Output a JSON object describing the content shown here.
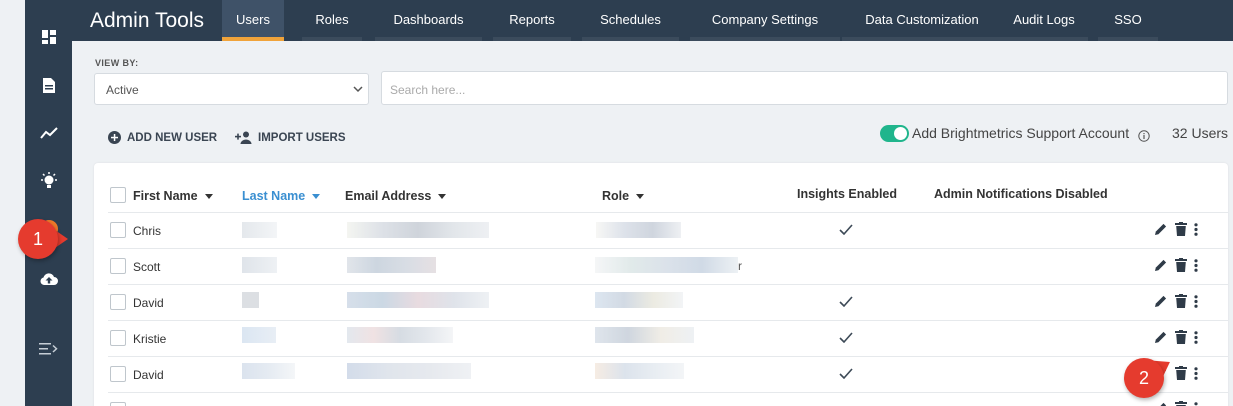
{
  "header": {
    "title": "Admin Tools",
    "tabs": [
      {
        "label": "Users",
        "active": true
      },
      {
        "label": "Roles"
      },
      {
        "label": "Dashboards"
      },
      {
        "label": "Reports"
      },
      {
        "label": "Schedules"
      },
      {
        "label": "Company Settings"
      },
      {
        "label": "Data Customization"
      },
      {
        "label": "Audit Logs"
      },
      {
        "label": "SSO"
      }
    ]
  },
  "sidebar": {
    "items": [
      {
        "icon": "dashboard-icon"
      },
      {
        "icon": "document-icon"
      },
      {
        "icon": "trend-line-icon"
      },
      {
        "icon": "lightbulb-icon"
      },
      {
        "icon": "admin-badge-icon"
      },
      {
        "icon": "cloud-upload-icon"
      },
      {
        "icon": "expand-menu-icon"
      }
    ]
  },
  "filters": {
    "view_by_label": "VIEW BY:",
    "view_by_value": "Active",
    "search_placeholder": "Search here..."
  },
  "actions": {
    "add_user": "ADD NEW USER",
    "import_users": "IMPORT USERS",
    "support_toggle_label": "Add Brightmetrics Support Account",
    "support_toggle_on": true,
    "user_count": "32 Users"
  },
  "table": {
    "columns": {
      "first_name": "First Name",
      "last_name": "Last Name",
      "email": "Email Address",
      "role": "Role",
      "insights": "Insights Enabled",
      "admin_notifications": "Admin Notifications Disabled"
    },
    "sorted_column": "Last Name",
    "rows": [
      {
        "first_name": "Chris",
        "insights_enabled": true,
        "role_suffix": ""
      },
      {
        "first_name": "Scott",
        "insights_enabled": false,
        "role_suffix": "r"
      },
      {
        "first_name": "David",
        "insights_enabled": true,
        "role_suffix": ""
      },
      {
        "first_name": "Kristie",
        "insights_enabled": true,
        "role_suffix": ""
      },
      {
        "first_name": "David",
        "insights_enabled": true,
        "role_suffix": ""
      }
    ]
  },
  "callouts": {
    "step1": "1",
    "step2": "2"
  },
  "colors": {
    "nav_bg": "#2d3e50",
    "active_tab_accent": "#f0a33a",
    "toggle_on": "#20b58c",
    "sorted_column": "#3a8fd1",
    "callout": "#e53b2e"
  }
}
